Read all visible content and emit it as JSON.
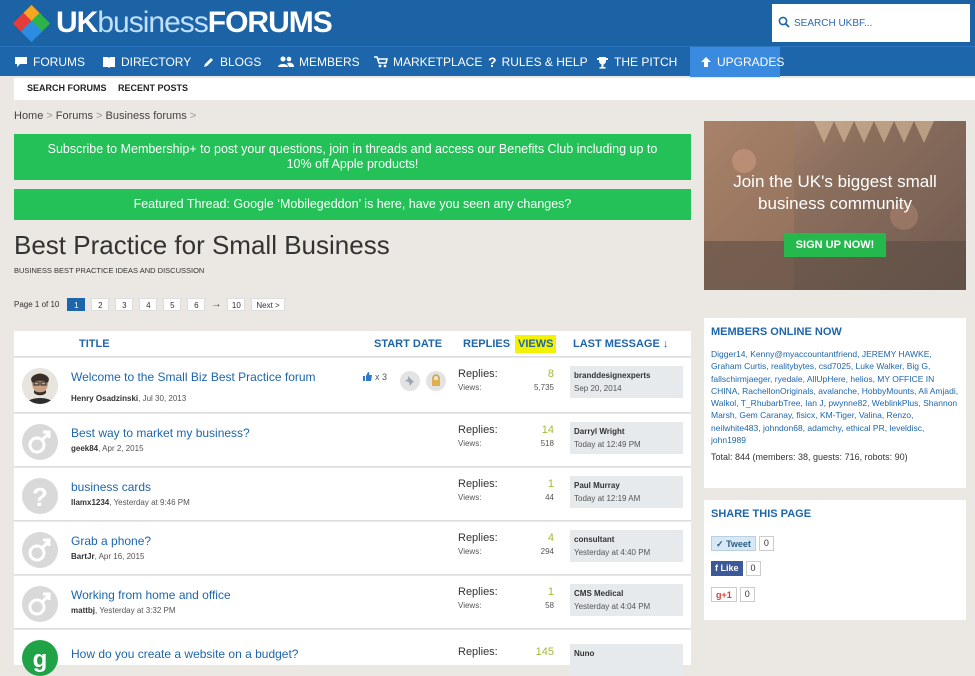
{
  "header": {
    "brand_uk": "UK",
    "brand_business": "business",
    "brand_forums": "FORUMS",
    "search_placeholder": "SEARCH UKBF..."
  },
  "nav": {
    "items": [
      {
        "label": "FORUMS",
        "icon": "chat-icon"
      },
      {
        "label": "DIRECTORY",
        "icon": "book-icon"
      },
      {
        "label": "BLOGS",
        "icon": "pencil-icon"
      },
      {
        "label": "MEMBERS",
        "icon": "users-icon"
      },
      {
        "label": "MARKETPLACE",
        "icon": "cart-icon"
      },
      {
        "label": "RULES & HELP",
        "icon": "question-icon"
      },
      {
        "label": "THE PITCH",
        "icon": "trophy-icon"
      },
      {
        "label": "UPGRADES",
        "icon": "arrow-up-icon"
      }
    ]
  },
  "subnav": {
    "search_forums": "SEARCH FORUMS",
    "recent_posts": "RECENT POSTS"
  },
  "breadcrumb": [
    "Home",
    "Forums",
    "Business forums"
  ],
  "banners": {
    "membership": "Subscribe to Membership+ to post your questions, join in threads and access our Benefits Club including up to 10% off Apple products!",
    "featured": "Featured Thread: Google ‘Mobilegeddon’ is here, have you seen any changes?"
  },
  "page": {
    "title": "Best Practice for Small Business",
    "subtitle": "BUSINESS BEST PRACTICE IDEAS AND DISCUSSION"
  },
  "pager": {
    "label": "Page 1 of 10",
    "pages": [
      "1",
      "2",
      "3",
      "4",
      "5",
      "6"
    ],
    "arrow": "→",
    "last": "10",
    "next": "Next >"
  },
  "columns": {
    "title": "TITLE",
    "start_date": "START DATE",
    "replies": "REPLIES",
    "views": "VIEWS",
    "last_message": "LAST MESSAGE ↓"
  },
  "threads": [
    {
      "title": "Welcome to the Small Biz Best Practice forum",
      "author": "Henry Osadzinski",
      "date": "Jul 30, 2013",
      "likes": "x 3",
      "replies": "8",
      "views": "5,735",
      "last_user": "branddesignexperts",
      "last_date": "Sep 20, 2014"
    },
    {
      "title": "Best way to market my business?",
      "author": "geek84",
      "date": "Apr 2, 2015",
      "replies": "14",
      "views": "518",
      "last_user": "Darryl Wright",
      "last_date": "Today at 12:49 PM"
    },
    {
      "title": "business cards",
      "author": "llamx1234",
      "date": "Yesterday at 9:46 PM",
      "replies": "1",
      "views": "44",
      "last_user": "Paul Murray",
      "last_date": "Today at 12:19 AM"
    },
    {
      "title": "Grab a phone?",
      "author": "BartJr",
      "date": "Apr 16, 2015",
      "replies": "4",
      "views": "294",
      "last_user": "consultant",
      "last_date": "Yesterday at 4:40 PM"
    },
    {
      "title": "Working from home and office",
      "author": "mattbj",
      "date": "Yesterday at 3:32 PM",
      "replies": "1",
      "views": "58",
      "last_user": "CMS Medical",
      "last_date": "Yesterday at 4:04 PM"
    },
    {
      "title": "How do you create a website on a budget?",
      "author": "",
      "date": "",
      "replies": "145",
      "views": "",
      "last_user": "Nuno",
      "last_date": ""
    }
  ],
  "stat_labels": {
    "replies": "Replies:",
    "views": "Views:"
  },
  "promo": {
    "text": "Join the UK's biggest small business community",
    "button": "SIGN UP NOW!"
  },
  "members_online": {
    "heading": "MEMBERS ONLINE NOW",
    "list": "Digger14, Kenny@myaccountantfriend, JEREMY HAWKE, Graham Curtis, realitybytes, csd7025, Luke Walker, Big G, fallschirmjaeger, ryedale, AllUpHere, helios, MY OFFICE IN CHINA, RachellonOriginals, avalanche, HobbyMounts, Ali Amjadi, Walkol, T_RhubarbTree, Ian J, pwynne82, WeblinkPlus, Shannon Marsh, Gem Caranay, fisicx, KM-Tiger, Valina, Renzo, neilwhite483, johndon68, adamchy, ethical PR, leveldisc, john1989",
    "total": "Total: 844 (members: 38, guests: 716, robots: 90)"
  },
  "share": {
    "heading": "SHARE THIS PAGE",
    "tweet": "Tweet",
    "tweet_count": "0",
    "like": "Like",
    "like_count": "0",
    "gplus": "g+1",
    "gplus_count": "0"
  },
  "colors": {
    "brand_blue": "#1c63a6",
    "nav_active": "#3a8ae0",
    "banner_green": "#24c058",
    "link_blue": "#1e66ab",
    "highlight": "#f3f200"
  }
}
